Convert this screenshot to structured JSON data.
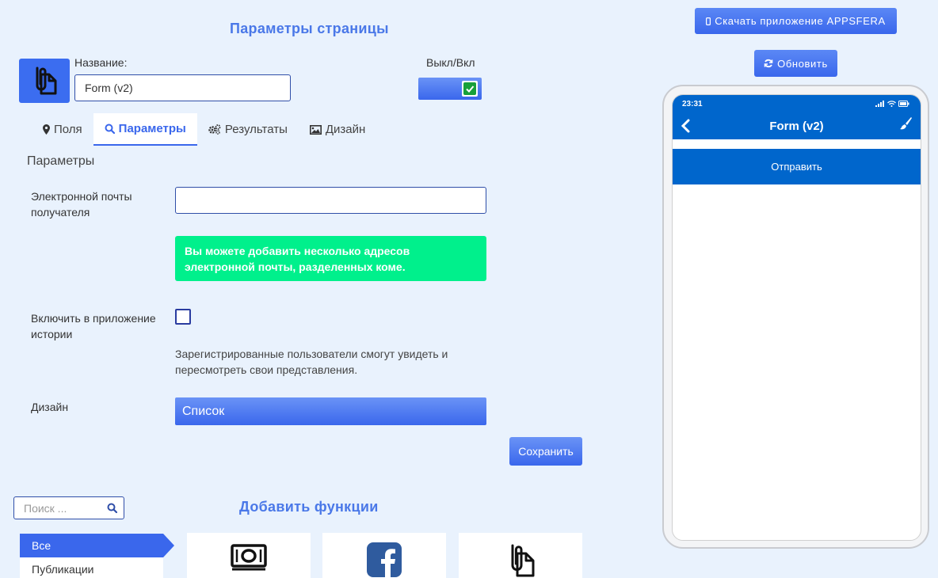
{
  "header": {
    "title": "Параметры страницы"
  },
  "name_field": {
    "label": "Название:",
    "value": "Form (v2)"
  },
  "toggle": {
    "label": "Выкл/Вкл",
    "enabled": true
  },
  "tabs": [
    {
      "label": "Поля",
      "icon": "map-marker-icon"
    },
    {
      "label": "Параметры",
      "icon": "search-icon",
      "active": true
    },
    {
      "label": "Результаты",
      "icon": "gears-icon"
    },
    {
      "label": "Дизайн",
      "icon": "image-icon"
    }
  ],
  "params": {
    "title": "Параметры",
    "email_label": "Электронной почты получателя",
    "email_value": "",
    "email_hint": "Вы можете добавить несколько адресов электронной почты, разделенных коме.",
    "history_label": "Включить в приложение истории",
    "history_checked": false,
    "history_note": "Зарегистрированные пользователи смогут увидеть и пересмотреть свои представления.",
    "design_label": "Дизайн",
    "design_value": "Список",
    "save_label": "Сохранить"
  },
  "functions": {
    "search_placeholder": "Поиск ...",
    "title": "Добавить функции",
    "categories": [
      {
        "label": "Все",
        "active": true
      },
      {
        "label": "Публикации"
      }
    ],
    "cards": [
      {
        "icon": "money-icon"
      },
      {
        "icon": "facebook-icon"
      },
      {
        "icon": "paperclip-doc-icon"
      }
    ]
  },
  "topbar": {
    "download_label": "Скачать приложение APPSFERA",
    "refresh_label": "Обновить"
  },
  "phone_preview": {
    "time": "23:31",
    "title": "Form (v2)",
    "submit_label": "Отправить"
  },
  "colors": {
    "accent": "#3a67ec",
    "hint_green": "#00f08c",
    "preview_blue": "#0066cc",
    "background": "#e9f2fd"
  }
}
